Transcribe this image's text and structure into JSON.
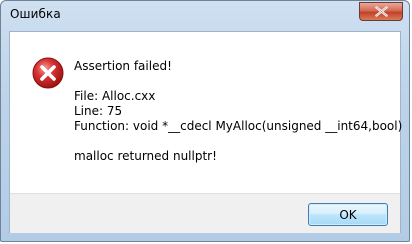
{
  "window": {
    "title": "Ошибка",
    "close_glyph": "x"
  },
  "dialog": {
    "icon": "error-icon",
    "lines": {
      "heading": "Assertion failed!",
      "file": "File: Alloc.cxx",
      "line": "Line: 75",
      "function": "Function: void *__cdecl MyAlloc(unsigned __int64,bool)",
      "detail": "malloc returned nullptr!"
    },
    "ok_label": "OK"
  },
  "colors": {
    "error_red": "#d12a2a",
    "titlebar": "#bcd3ea",
    "close_button": "#c2412a"
  }
}
